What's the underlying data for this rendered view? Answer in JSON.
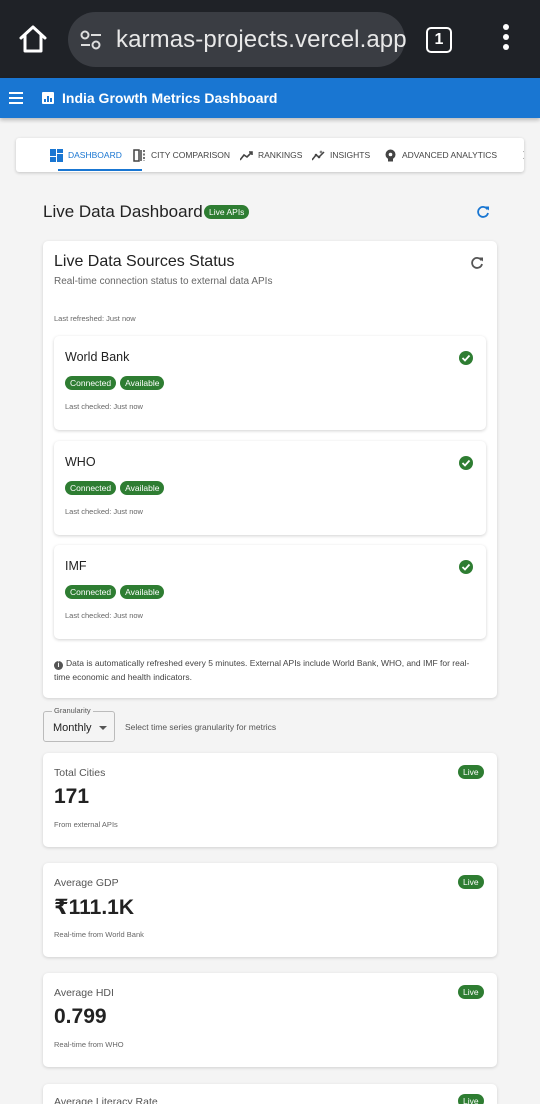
{
  "browser": {
    "url": "karmas-projects.vercel.app",
    "tab_count": "1"
  },
  "app_bar": {
    "title": "India Growth Metrics Dashboard",
    "color": "#1976d2"
  },
  "tabs": [
    {
      "label": "DASHBOARD",
      "icon": "dashboard-icon",
      "active": true
    },
    {
      "label": "CITY COMPARISON",
      "icon": "compare-icon",
      "active": false
    },
    {
      "label": "RANKINGS",
      "icon": "trending-up-icon",
      "active": false
    },
    {
      "label": "INSIGHTS",
      "icon": "insights-icon",
      "active": false
    },
    {
      "label": "ADVANCED ANALYTICS",
      "icon": "psychology-icon",
      "active": false
    }
  ],
  "page": {
    "title": "Live Data Dashboard",
    "badge": "Live APIs"
  },
  "sources": {
    "title": "Live Data Sources Status",
    "subtitle": "Real-time connection status to external data APIs",
    "last_refreshed": "Last refreshed: Just now",
    "items": [
      {
        "name": "World Bank",
        "status": "Connected",
        "availability": "Available",
        "checked": "Last checked: Just now"
      },
      {
        "name": "WHO",
        "status": "Connected",
        "availability": "Available",
        "checked": "Last checked: Just now"
      },
      {
        "name": "IMF",
        "status": "Connected",
        "availability": "Available",
        "checked": "Last checked: Just now"
      }
    ],
    "note": "Data is automatically refreshed every 5 minutes. External APIs include World Bank, WHO, and IMF for real-time economic and health indicators."
  },
  "granularity": {
    "label": "Granularity",
    "value": "Monthly",
    "help": "Select time series granularity for metrics"
  },
  "metrics": [
    {
      "label": "Total Cities",
      "value": "171",
      "source": "From external APIs",
      "badge": "Live"
    },
    {
      "label": "Average GDP",
      "value": "₹111.1K",
      "source": "Real-time from World Bank",
      "badge": "Live"
    },
    {
      "label": "Average HDI",
      "value": "0.799",
      "source": "Real-time from WHO",
      "badge": "Live"
    },
    {
      "label": "Average Literacy Rate",
      "value": "",
      "source": "",
      "badge": "Live"
    }
  ],
  "colors": {
    "live_green": "#2e7d32",
    "primary": "#1976d2"
  }
}
